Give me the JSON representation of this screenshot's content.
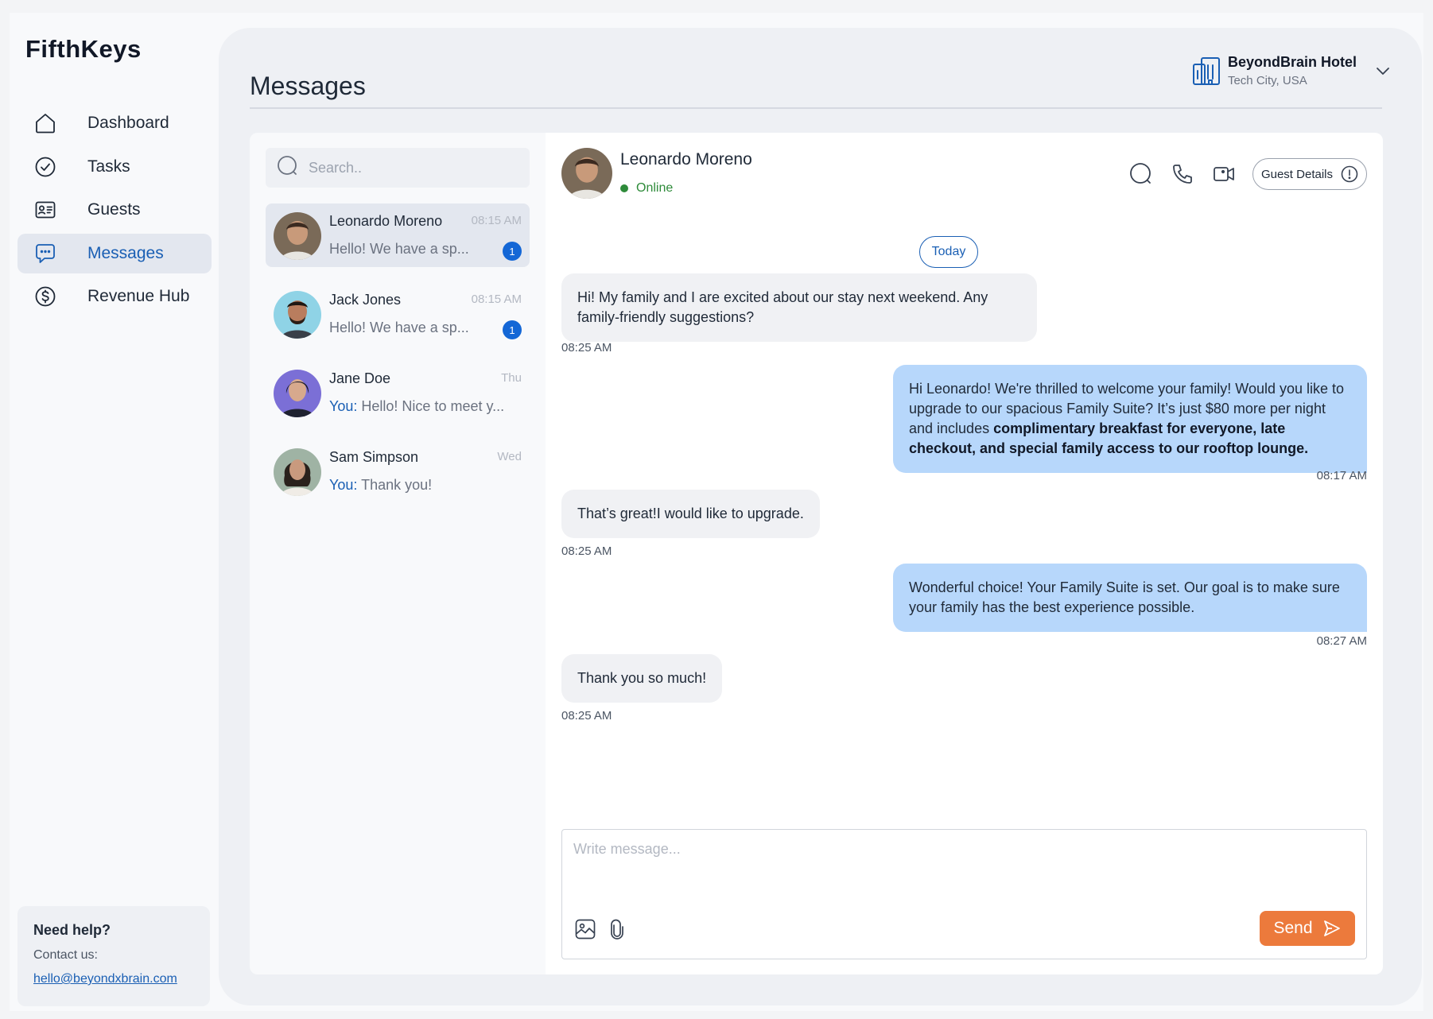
{
  "brand": "FifthKeys",
  "nav": {
    "items": [
      {
        "label": "Dashboard",
        "icon": "home-icon"
      },
      {
        "label": "Tasks",
        "icon": "check-circle-icon"
      },
      {
        "label": "Guests",
        "icon": "id-card-icon"
      },
      {
        "label": "Messages",
        "icon": "chat-icon",
        "active": true
      },
      {
        "label": "Revenue Hub",
        "icon": "dollar-icon"
      }
    ]
  },
  "help": {
    "title": "Need help?",
    "contact_label": "Contact us:",
    "email": "hello@beyondxbrain.com"
  },
  "header": {
    "title": "Messages",
    "hotel_name": "BeyondBrain Hotel",
    "hotel_location": "Tech City, USA"
  },
  "search": {
    "placeholder": "Search.."
  },
  "conversations": [
    {
      "name": "Leonardo Moreno",
      "time": "08:15 AM",
      "you_prefix": "",
      "preview": "Hello! We have a sp...",
      "unread": "1",
      "active": true
    },
    {
      "name": "Jack Jones",
      "time": "08:15 AM",
      "you_prefix": "",
      "preview": "Hello! We have a sp...",
      "unread": "1"
    },
    {
      "name": "Jane Doe",
      "time": "Thu",
      "you_prefix": "You:",
      "preview": "Hello! Nice to meet y...",
      "unread": ""
    },
    {
      "name": "Sam Simpson",
      "time": "Wed",
      "you_prefix": "You:",
      "preview": "Thank you!",
      "unread": ""
    }
  ],
  "chat": {
    "contact_name": "Leonardo Moreno",
    "status": "Online",
    "guest_details_label": "Guest Details",
    "day_label": "Today",
    "messages": [
      {
        "direction": "in",
        "text": "Hi! My family and I are excited about our stay next weekend. Any family-friendly suggestions?",
        "time": "08:25 AM"
      },
      {
        "direction": "out",
        "text": "Hi Leonardo! We're thrilled to welcome your family! Would you like to upgrade to our spacious Family Suite? It’s just $80 more per night and includes ",
        "bold": "complimentary breakfast for everyone, late checkout, and special family access to our rooftop lounge.",
        "time": "08:17 AM"
      },
      {
        "direction": "in",
        "text": "That’s great!I would like to upgrade.",
        "time": "08:25 AM"
      },
      {
        "direction": "out",
        "text": "Wonderful choice! Your Family Suite is set. Our goal is to make sure your family has the best experience possible.",
        "time": "08:27 AM"
      },
      {
        "direction": "in",
        "text": "Thank you so much!",
        "time": "08:25 AM"
      }
    ]
  },
  "composer": {
    "placeholder": "Write message...",
    "send_label": "Send"
  },
  "colors": {
    "accent": "#1a5fb4",
    "send": "#ec7a3c",
    "outgoing_bubble": "#b7d7fb",
    "incoming_bubble": "#f0f1f4",
    "online": "#2e8b3a"
  }
}
